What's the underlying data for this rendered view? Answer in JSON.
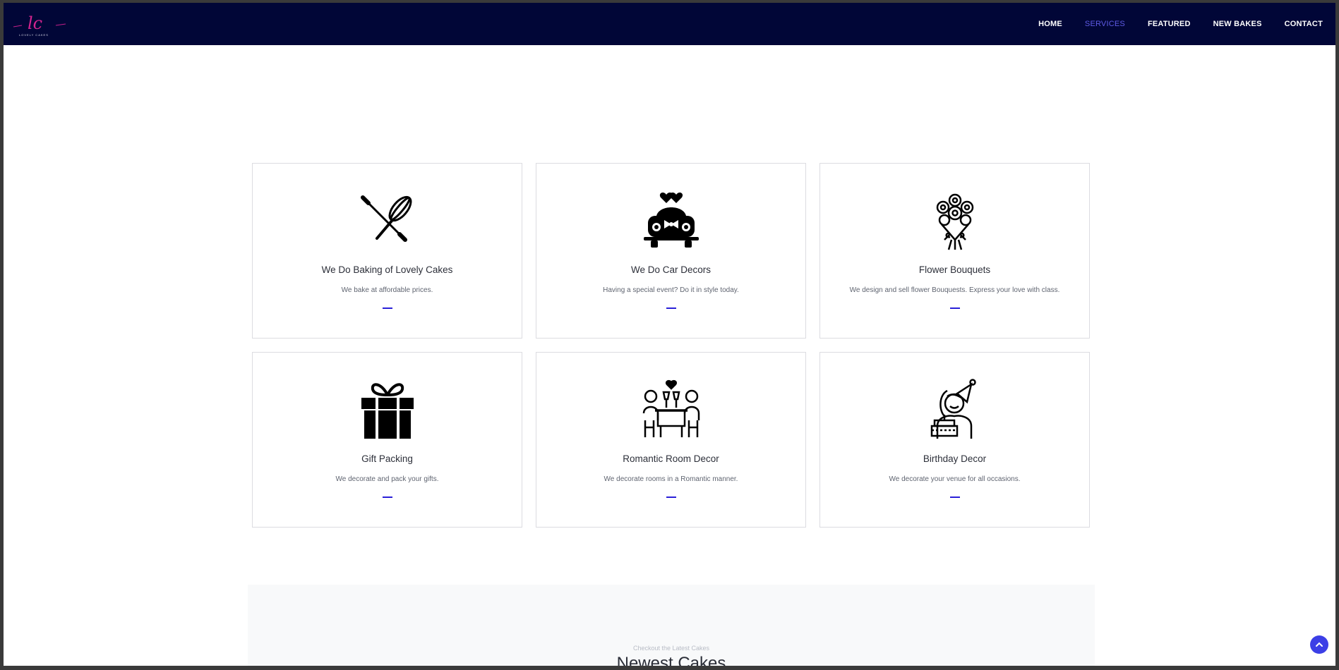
{
  "brand": {
    "logo_text": "lc",
    "logo_subtext": "LOVELY CAKES"
  },
  "nav": {
    "items": [
      {
        "label": "HOME"
      },
      {
        "label": "SERVICES",
        "active": true
      },
      {
        "label": "FEATURED"
      },
      {
        "label": "NEW BAKES"
      },
      {
        "label": "CONTACT"
      }
    ]
  },
  "services": [
    {
      "icon": "whisk-rolling-pin-icon",
      "title": "We Do Baking of Lovely Cakes",
      "description": "We bake at affordable prices."
    },
    {
      "icon": "wedding-car-icon",
      "title": "We Do Car Decors",
      "description": "Having a special event? Do it in style today."
    },
    {
      "icon": "flower-bouquet-icon",
      "title": "Flower Bouquets",
      "description": "We design and sell flower Bouquests. Express your love with class."
    },
    {
      "icon": "gift-box-icon",
      "title": "Gift Packing",
      "description": "We decorate and pack your gifts."
    },
    {
      "icon": "romantic-dinner-icon",
      "title": "Romantic Room Decor",
      "description": "We decorate rooms in a Romantic manner."
    },
    {
      "icon": "birthday-person-icon",
      "title": "Birthday Decor",
      "description": "We decorate your venue for all occasions."
    }
  ],
  "newest": {
    "subtitle": "Checkout the Latest Cakes",
    "title": "Newest Cakes"
  },
  "colors": {
    "navbar_bg": "#010637",
    "nav_active": "#5e5be6",
    "accent": "#2a20d8",
    "back_to_top": "#3c3fe6"
  }
}
